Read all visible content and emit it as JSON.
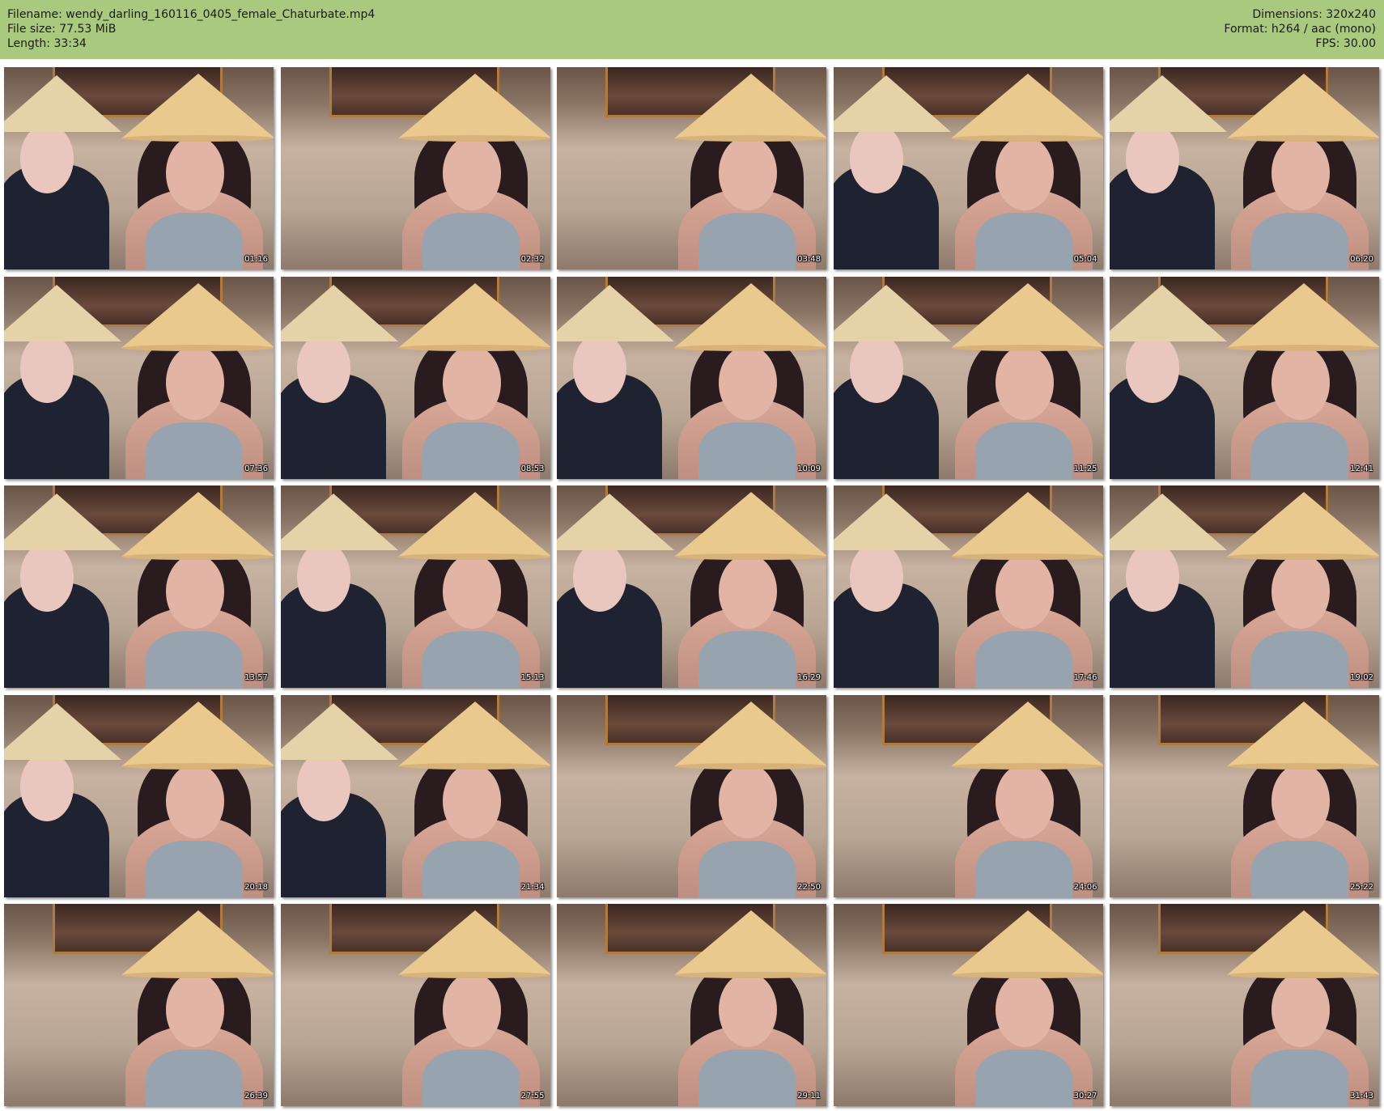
{
  "header": {
    "filename": "Filename: wendy_darling_160116_0405_female_Chaturbate.mp4",
    "filesize": "File size: 77.53 MiB",
    "length": "Length: 33:34",
    "dimensions": "Dimensions: 320x240",
    "format": "Format: h264 / aac (mono)",
    "fps": "FPS: 30.00"
  },
  "colors": {
    "header_bg": "#a9c97f",
    "page_bg": "#ffffff",
    "hat": "#e9c98e"
  },
  "thumbnails": [
    {
      "timestamp": "01:16",
      "second_person": true
    },
    {
      "timestamp": "02:32",
      "second_person": false
    },
    {
      "timestamp": "03:48",
      "second_person": false
    },
    {
      "timestamp": "05:04",
      "second_person": true
    },
    {
      "timestamp": "06:20",
      "second_person": true
    },
    {
      "timestamp": "07:36",
      "second_person": true
    },
    {
      "timestamp": "08:53",
      "second_person": true
    },
    {
      "timestamp": "10:09",
      "second_person": true
    },
    {
      "timestamp": "11:25",
      "second_person": true
    },
    {
      "timestamp": "12:41",
      "second_person": true
    },
    {
      "timestamp": "13:57",
      "second_person": true
    },
    {
      "timestamp": "15:13",
      "second_person": true
    },
    {
      "timestamp": "16:29",
      "second_person": true
    },
    {
      "timestamp": "17:46",
      "second_person": true
    },
    {
      "timestamp": "19:02",
      "second_person": true
    },
    {
      "timestamp": "20:18",
      "second_person": true
    },
    {
      "timestamp": "21:34",
      "second_person": true
    },
    {
      "timestamp": "22:50",
      "second_person": false
    },
    {
      "timestamp": "24:06",
      "second_person": false
    },
    {
      "timestamp": "25:22",
      "second_person": false
    },
    {
      "timestamp": "26:39",
      "second_person": false
    },
    {
      "timestamp": "27:55",
      "second_person": false
    },
    {
      "timestamp": "29:11",
      "second_person": false
    },
    {
      "timestamp": "30:27",
      "second_person": false
    },
    {
      "timestamp": "31:43",
      "second_person": false
    }
  ]
}
